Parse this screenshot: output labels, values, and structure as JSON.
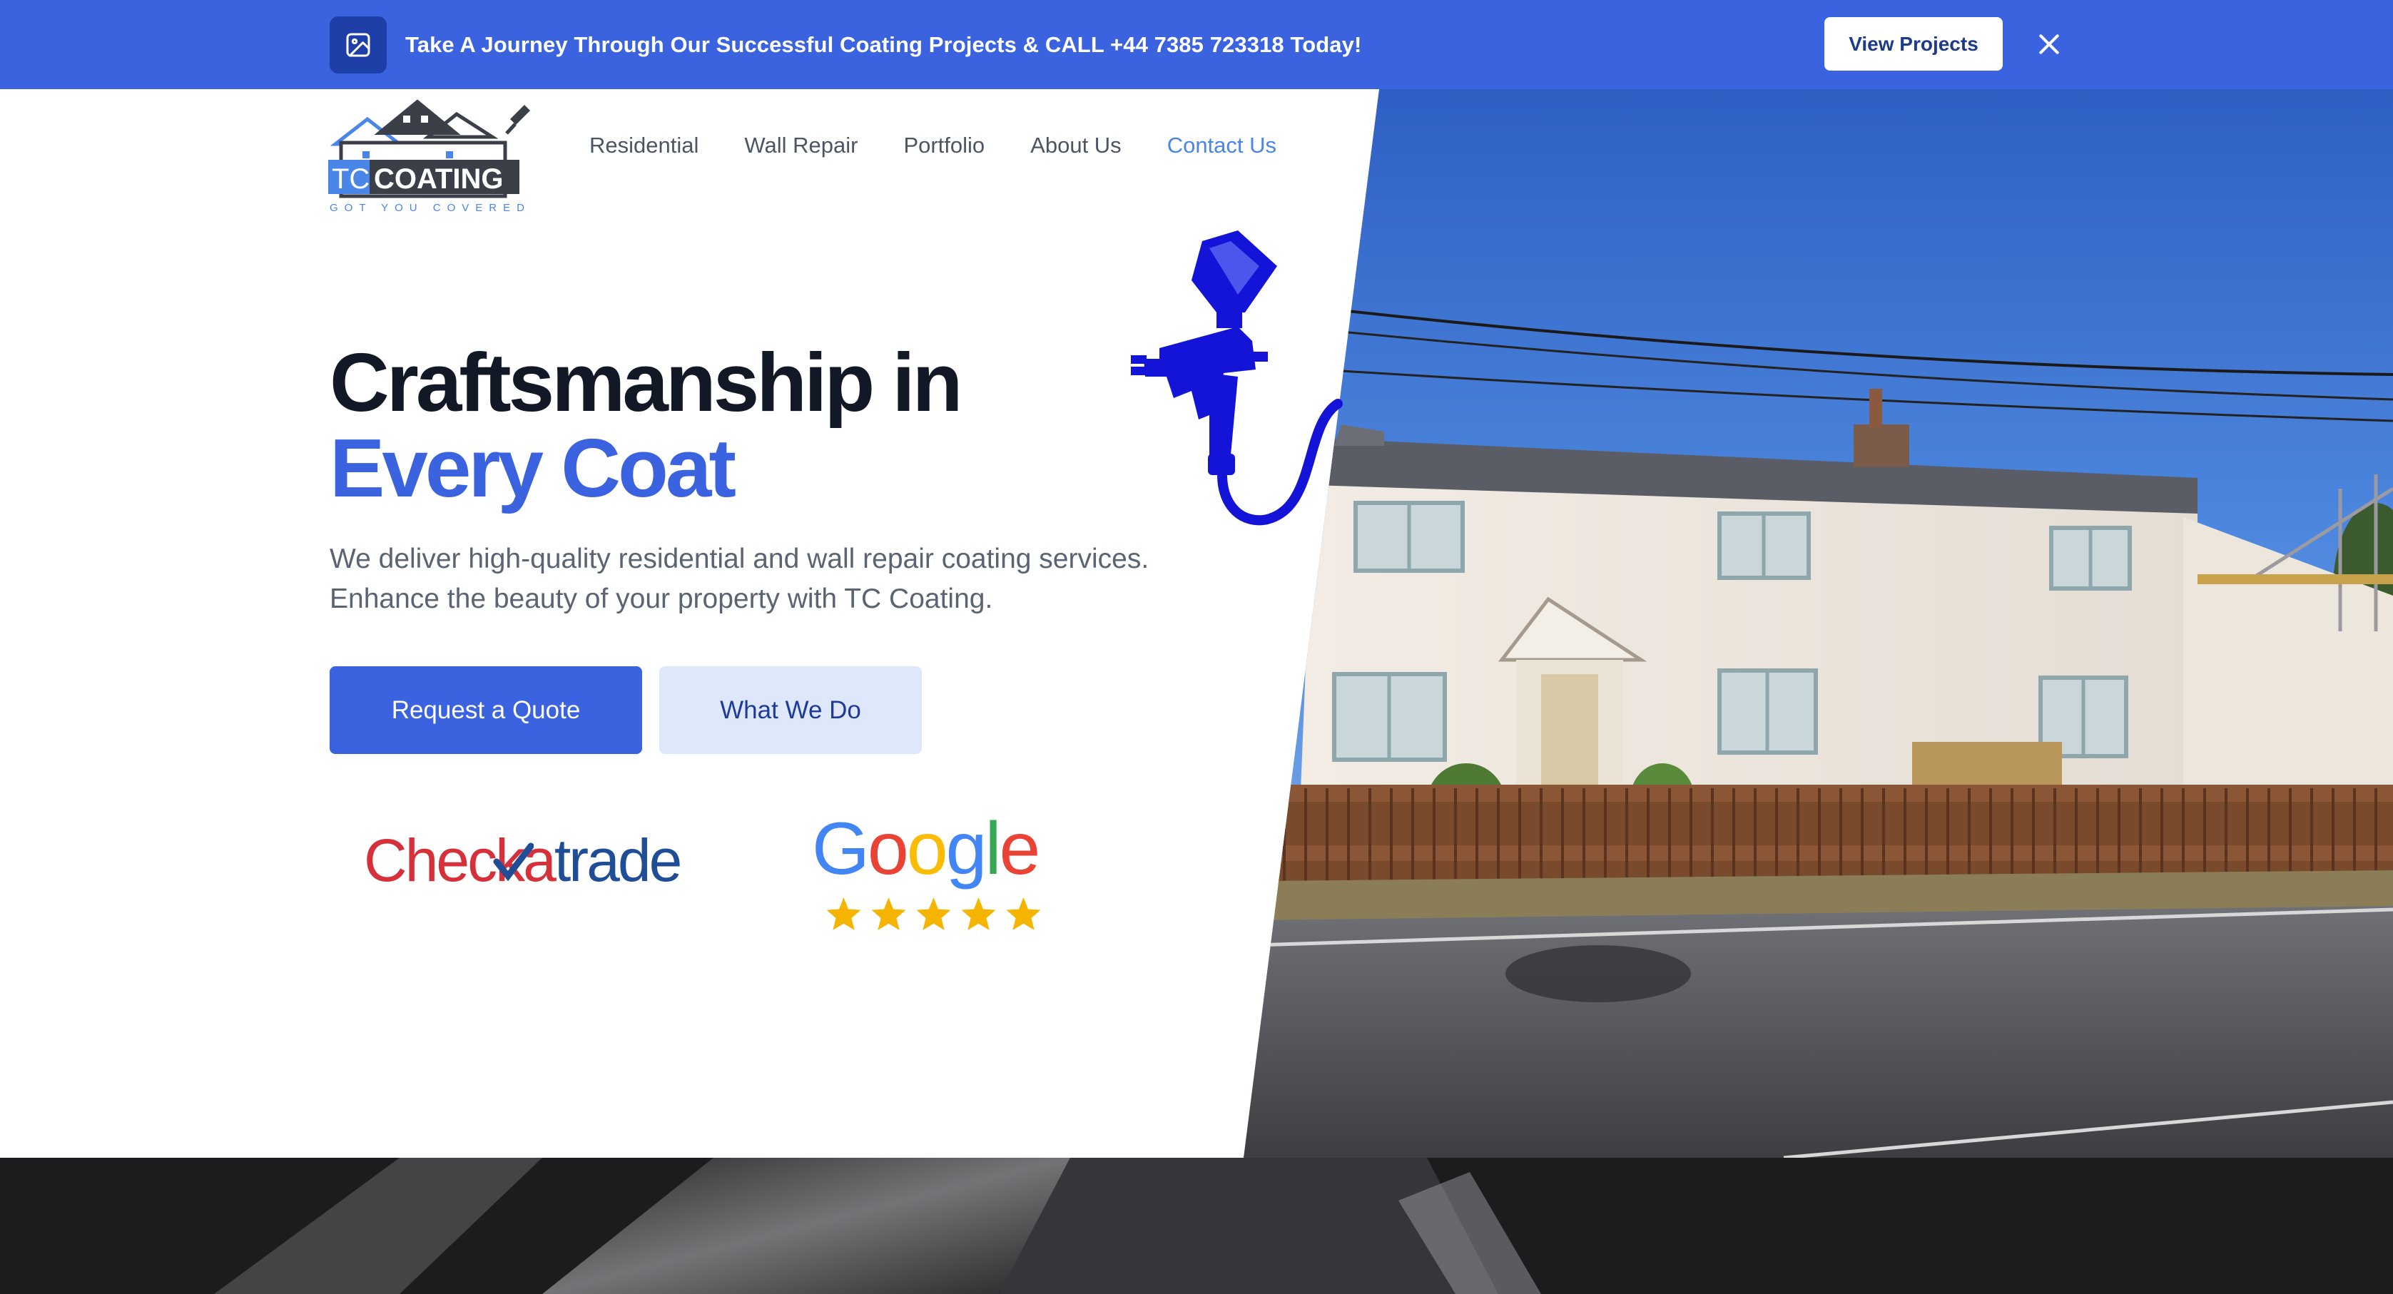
{
  "banner": {
    "icon": "image-icon",
    "text": "Take A Journey Through Our Successful Coating Projects & CALL +44 7385 723318 Today!",
    "button_label": "View Projects",
    "close_icon": "close-icon"
  },
  "logo": {
    "brand_tc": "TC",
    "brand_coating": "COATING",
    "tagline": "GOT YOU COVERED"
  },
  "nav": {
    "items": [
      {
        "label": "Residential"
      },
      {
        "label": "Wall Repair"
      },
      {
        "label": "Portfolio"
      },
      {
        "label": "About Us"
      },
      {
        "label": "Contact Us",
        "active": true
      }
    ]
  },
  "hero": {
    "title_line1": "Craftsmanship in",
    "title_line2": "Every Coat",
    "subtitle": "We deliver high-quality residential and wall repair coating services. Enhance the beauty of your property with TC Coating.",
    "primary_button": "Request a Quote",
    "secondary_button": "What We Do"
  },
  "trust": {
    "checkatrade": {
      "part1": "Chec",
      "part2": "k",
      "part3": "a",
      "part4": "trade"
    },
    "google": {
      "letters": [
        "G",
        "o",
        "o",
        "g",
        "l",
        "e"
      ],
      "rating": 5
    }
  },
  "colors": {
    "accent": "#3b63e0",
    "banner_bg": "#3b63e0",
    "heading": "#121826",
    "nav_active": "#4a86e8",
    "google_blue": "#4285f4",
    "google_red": "#ea4335",
    "google_yellow": "#fbbc05",
    "google_green": "#34a853",
    "star": "#f4b400"
  }
}
